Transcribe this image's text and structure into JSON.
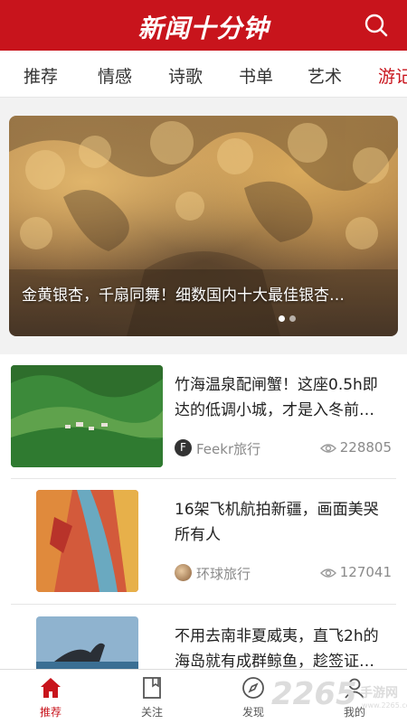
{
  "header": {
    "title": "新闻十分钟"
  },
  "tabs": [
    {
      "label": "推荐"
    },
    {
      "label": "情感"
    },
    {
      "label": "诗歌"
    },
    {
      "label": "书单"
    },
    {
      "label": "艺术"
    },
    {
      "label": "游记"
    }
  ],
  "active_tab": "游记",
  "banner": {
    "caption": "金黄银杏，千扇同舞！细数国内十大最佳银杏…",
    "slide_count": 2,
    "active_slide": 1
  },
  "feed": [
    {
      "title": "竹海温泉配闸蟹！这座0.5h即达的低调小城，才是入冬前…",
      "source": "Feekr旅行",
      "source_icon_letter": "F",
      "views": "228805"
    },
    {
      "title": "16架飞机航拍新疆，画面美哭所有人",
      "source": "环球旅行",
      "views": "127041"
    },
    {
      "title": "不用去南非夏威夷，直飞2h的海岛就有成群鲸鱼，趁签证…",
      "source": "",
      "views": ""
    }
  ],
  "bottom_nav": [
    {
      "label": "推荐"
    },
    {
      "label": "关注"
    },
    {
      "label": "发现"
    },
    {
      "label": "我的"
    }
  ],
  "watermark": {
    "number": "2265",
    "text": "手游网",
    "url": "www.2265.com"
  },
  "colors": {
    "brand": "#c8141c",
    "text": "#222222",
    "meta": "#8a8a8a"
  }
}
